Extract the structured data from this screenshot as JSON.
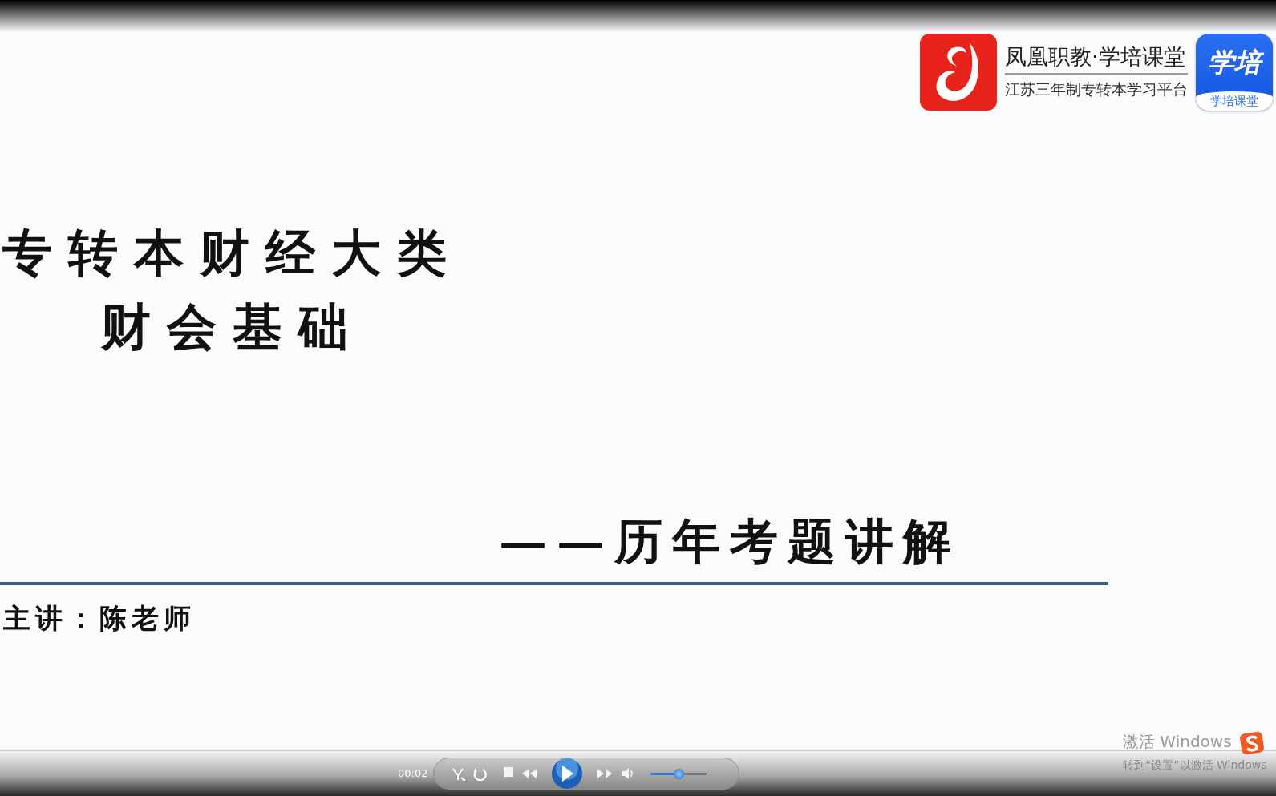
{
  "slide": {
    "title_lines": [
      "专转本财经大类",
      "财会基础"
    ],
    "subtitle": "——历年考题讲解",
    "speaker": "主讲：陈老师",
    "brand": {
      "name": "凤凰职教·学培课堂",
      "tagline": "江苏三年制专转本学习平台",
      "app_label": "学培",
      "app_caption": "学培课堂"
    }
  },
  "player": {
    "time": "00:02",
    "buttons": [
      {
        "kind": "shuffle"
      },
      {
        "kind": "repeat"
      },
      {
        "kind": "stop"
      },
      {
        "kind": "previous"
      },
      {
        "kind": "play"
      },
      {
        "kind": "next"
      },
      {
        "kind": "mute"
      }
    ],
    "volume": {
      "level": 0.5
    }
  },
  "activation": {
    "title": "激活 Windows",
    "hint": "转到“设置”以激活 Windows"
  }
}
